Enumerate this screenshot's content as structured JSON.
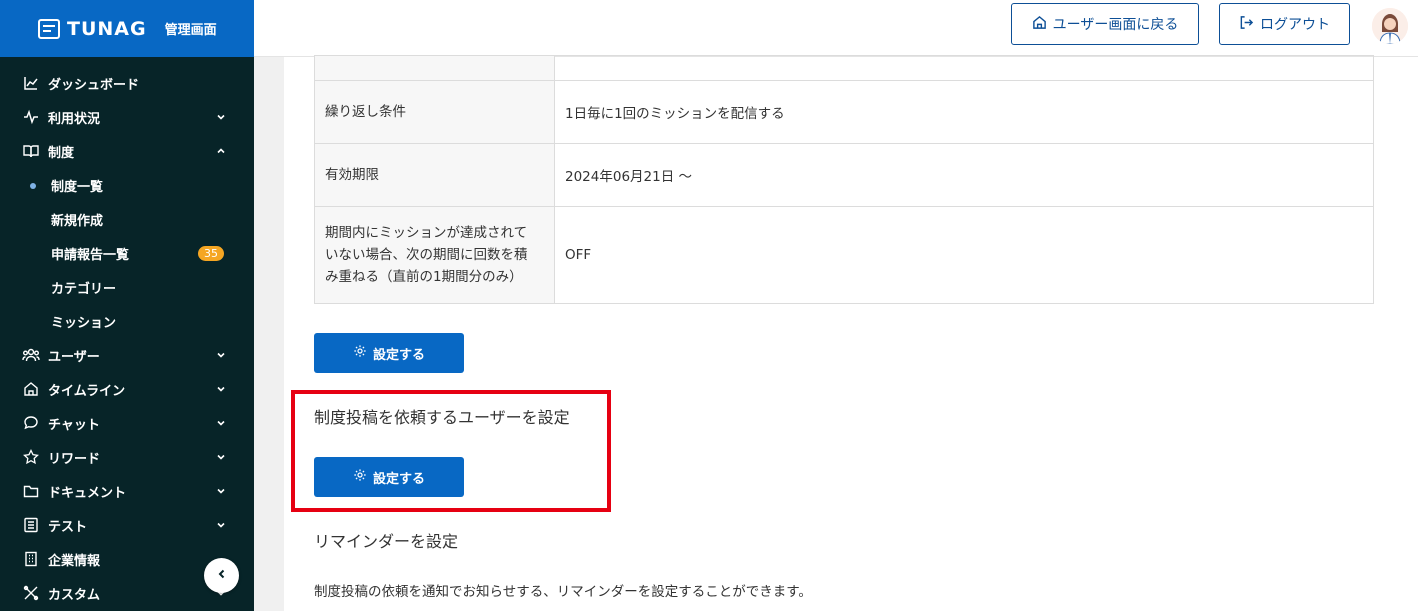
{
  "brand": {
    "name": "TUNAG",
    "sub": "管理画面"
  },
  "sidebar": {
    "items": [
      {
        "label": "ダッシュボード",
        "icon": "chart-line-icon",
        "chevron": ""
      },
      {
        "label": "利用状況",
        "icon": "pulse-icon",
        "chevron": "down"
      },
      {
        "label": "制度",
        "icon": "book-icon",
        "chevron": "up"
      },
      {
        "label": "ユーザー",
        "icon": "users-icon",
        "chevron": "down"
      },
      {
        "label": "タイムライン",
        "icon": "home-icon",
        "chevron": "down"
      },
      {
        "label": "チャット",
        "icon": "chat-bubble-icon",
        "chevron": "down"
      },
      {
        "label": "リワード",
        "icon": "star-icon",
        "chevron": "down"
      },
      {
        "label": "ドキュメント",
        "icon": "folder-icon",
        "chevron": "down"
      },
      {
        "label": "テスト",
        "icon": "list-icon",
        "chevron": "down"
      },
      {
        "label": "企業情報",
        "icon": "building-icon",
        "chevron": ""
      },
      {
        "label": "カスタム",
        "icon": "tools-icon",
        "chevron": "down"
      }
    ],
    "sub_items": [
      {
        "label": "制度一覧",
        "active": true
      },
      {
        "label": "新規作成"
      },
      {
        "label": "申請報告一覧",
        "badge": "35"
      },
      {
        "label": "カテゴリー"
      },
      {
        "label": "ミッション"
      }
    ]
  },
  "header": {
    "user_screen_label": "ユーザー画面に戻る",
    "logout_label": "ログアウト"
  },
  "table": {
    "rows": [
      {
        "key": "",
        "value": ""
      },
      {
        "key": "繰り返し条件",
        "value": "1日毎に1回のミッションを配信する"
      },
      {
        "key": "有効期限",
        "value": "2024年06月21日 〜"
      },
      {
        "key_lines": [
          "期間内にミッションが達成されて",
          "いない場合、次の期間に回数を積",
          "み重ねる（直前の1期間分のみ）"
        ],
        "value": "OFF"
      }
    ]
  },
  "buttons": {
    "set_label": "設定する"
  },
  "sections": {
    "request_user_title": "制度投稿を依頼するユーザーを設定",
    "reminder_title": "リマインダーを設定",
    "reminder_desc": "制度投稿の依頼を通知でお知らせする、リマインダーを設定することができます。"
  },
  "colors": {
    "brand_blue": "#0868c4",
    "sidebar_bg": "#072428",
    "highlight_red": "#e60012",
    "badge_orange": "#f5a623"
  }
}
